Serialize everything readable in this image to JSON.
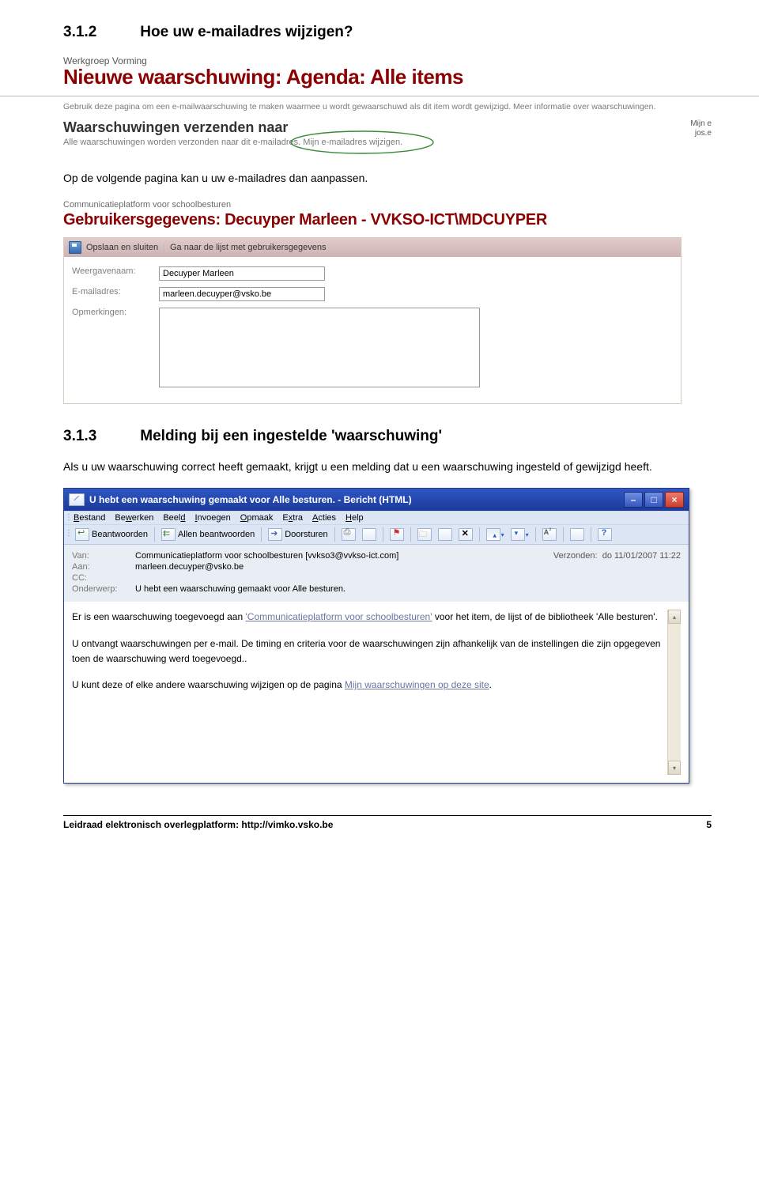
{
  "section312": {
    "num": "3.1.2",
    "title": "Hoe uw e-mailadres wijzigen?"
  },
  "para1": "Op de volgende pagina kan u uw e-mailadres dan aanpassen.",
  "section313": {
    "num": "3.1.3",
    "title": "Melding bij een ingestelde 'waarschuwing'"
  },
  "para2": "Als u uw waarschuwing correct heeft gemaakt, krijgt u een melding dat u een waarschuwing ingesteld of gewijzigd heeft.",
  "sp1": {
    "brand": "Werkgroep Vorming",
    "title": "Nieuwe waarschuwing: Agenda: Alle items",
    "desc": "Gebruik deze pagina om een e-mailwaarschuwing te maken waarmee u wordt gewaarschuwd als dit item wordt gewijzigd. Meer informatie over waarschuwingen.",
    "subhead": "Waarschuwingen verzenden naar",
    "sendline_a": "Alle waarschuwingen worden verzonden naar dit e-mailadres. ",
    "sendline_link": "Mijn e-mailadres wijzigen.",
    "right1": "Mijn e",
    "right2": "jos.e"
  },
  "sp2": {
    "brand": "Communicatieplatform voor schoolbesturen",
    "title": "Gebruikersgegevens: Decuyper Marleen - VVKSO-ICT\\MDCUYPER",
    "tb_save": "Opslaan en sluiten",
    "tb_list": "Ga naar de lijst met gebruikersgegevens",
    "label_name": "Weergavenaam:",
    "val_name": "Decuyper Marleen",
    "label_mail": "E-mailadres:",
    "val_mail": "marleen.decuyper@vsko.be",
    "label_notes": "Opmerkingen:"
  },
  "ol": {
    "title": "U hebt een waarschuwing gemaakt voor Alle besturen. - Bericht (HTML)",
    "menu": [
      "Bestand",
      "Bewerken",
      "Beeld",
      "Invoegen",
      "Opmaak",
      "Extra",
      "Acties",
      "Help"
    ],
    "tb_reply": "Beantwoorden",
    "tb_replyall": "Allen beantwoorden",
    "tb_fwd": "Doorsturen",
    "from_l": "Van:",
    "from_v": "Communicatieplatform voor schoolbesturen [vvkso3@vvkso-ict.com]",
    "sent_l": "Verzonden:",
    "sent_v": "do 11/01/2007 11:22",
    "to_l": "Aan:",
    "to_v": "marleen.decuyper@vsko.be",
    "cc_l": "CC:",
    "subj_l": "Onderwerp:",
    "subj_v": "U hebt een waarschuwing gemaakt voor Alle besturen.",
    "body_p1a": "Er is een waarschuwing toegevoegd aan ",
    "body_link1": "'Communicatieplatform voor schoolbesturen'",
    "body_p1b": " voor het item, de lijst of de bibliotheek 'Alle besturen'.",
    "body_p2": "U ontvangt waarschuwingen per e-mail. De timing en criteria voor de waarschuwingen zijn afhankelijk van de instellingen die zijn opgegeven toen de waarschuwing werd toegevoegd..",
    "body_p3a": "U kunt deze of elke andere waarschuwing wijzigen op de pagina ",
    "body_link2": "Mijn waarschuwingen op deze site",
    "body_p3b": "."
  },
  "footer": {
    "left": "Leidraad elektronisch overlegplatform: http://vimko.vsko.be",
    "right": "5"
  }
}
